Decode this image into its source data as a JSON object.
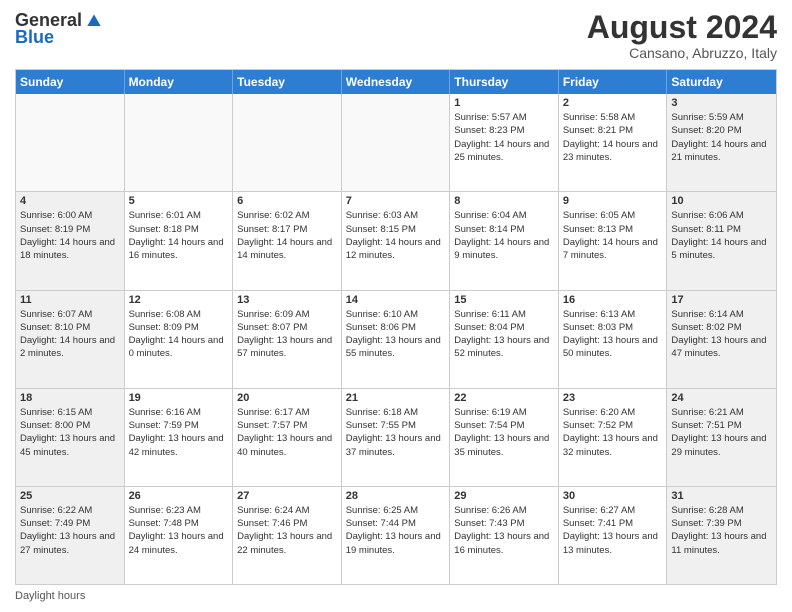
{
  "logo": {
    "general": "General",
    "blue": "Blue"
  },
  "title": "August 2024",
  "subtitle": "Cansano, Abruzzo, Italy",
  "days_of_week": [
    "Sunday",
    "Monday",
    "Tuesday",
    "Wednesday",
    "Thursday",
    "Friday",
    "Saturday"
  ],
  "footer_text": "Daylight hours",
  "weeks": [
    [
      {
        "day": "",
        "info": ""
      },
      {
        "day": "",
        "info": ""
      },
      {
        "day": "",
        "info": ""
      },
      {
        "day": "",
        "info": ""
      },
      {
        "day": "1",
        "info": "Sunrise: 5:57 AM\nSunset: 8:23 PM\nDaylight: 14 hours and 25 minutes."
      },
      {
        "day": "2",
        "info": "Sunrise: 5:58 AM\nSunset: 8:21 PM\nDaylight: 14 hours and 23 minutes."
      },
      {
        "day": "3",
        "info": "Sunrise: 5:59 AM\nSunset: 8:20 PM\nDaylight: 14 hours and 21 minutes."
      }
    ],
    [
      {
        "day": "4",
        "info": "Sunrise: 6:00 AM\nSunset: 8:19 PM\nDaylight: 14 hours and 18 minutes."
      },
      {
        "day": "5",
        "info": "Sunrise: 6:01 AM\nSunset: 8:18 PM\nDaylight: 14 hours and 16 minutes."
      },
      {
        "day": "6",
        "info": "Sunrise: 6:02 AM\nSunset: 8:17 PM\nDaylight: 14 hours and 14 minutes."
      },
      {
        "day": "7",
        "info": "Sunrise: 6:03 AM\nSunset: 8:15 PM\nDaylight: 14 hours and 12 minutes."
      },
      {
        "day": "8",
        "info": "Sunrise: 6:04 AM\nSunset: 8:14 PM\nDaylight: 14 hours and 9 minutes."
      },
      {
        "day": "9",
        "info": "Sunrise: 6:05 AM\nSunset: 8:13 PM\nDaylight: 14 hours and 7 minutes."
      },
      {
        "day": "10",
        "info": "Sunrise: 6:06 AM\nSunset: 8:11 PM\nDaylight: 14 hours and 5 minutes."
      }
    ],
    [
      {
        "day": "11",
        "info": "Sunrise: 6:07 AM\nSunset: 8:10 PM\nDaylight: 14 hours and 2 minutes."
      },
      {
        "day": "12",
        "info": "Sunrise: 6:08 AM\nSunset: 8:09 PM\nDaylight: 14 hours and 0 minutes."
      },
      {
        "day": "13",
        "info": "Sunrise: 6:09 AM\nSunset: 8:07 PM\nDaylight: 13 hours and 57 minutes."
      },
      {
        "day": "14",
        "info": "Sunrise: 6:10 AM\nSunset: 8:06 PM\nDaylight: 13 hours and 55 minutes."
      },
      {
        "day": "15",
        "info": "Sunrise: 6:11 AM\nSunset: 8:04 PM\nDaylight: 13 hours and 52 minutes."
      },
      {
        "day": "16",
        "info": "Sunrise: 6:13 AM\nSunset: 8:03 PM\nDaylight: 13 hours and 50 minutes."
      },
      {
        "day": "17",
        "info": "Sunrise: 6:14 AM\nSunset: 8:02 PM\nDaylight: 13 hours and 47 minutes."
      }
    ],
    [
      {
        "day": "18",
        "info": "Sunrise: 6:15 AM\nSunset: 8:00 PM\nDaylight: 13 hours and 45 minutes."
      },
      {
        "day": "19",
        "info": "Sunrise: 6:16 AM\nSunset: 7:59 PM\nDaylight: 13 hours and 42 minutes."
      },
      {
        "day": "20",
        "info": "Sunrise: 6:17 AM\nSunset: 7:57 PM\nDaylight: 13 hours and 40 minutes."
      },
      {
        "day": "21",
        "info": "Sunrise: 6:18 AM\nSunset: 7:55 PM\nDaylight: 13 hours and 37 minutes."
      },
      {
        "day": "22",
        "info": "Sunrise: 6:19 AM\nSunset: 7:54 PM\nDaylight: 13 hours and 35 minutes."
      },
      {
        "day": "23",
        "info": "Sunrise: 6:20 AM\nSunset: 7:52 PM\nDaylight: 13 hours and 32 minutes."
      },
      {
        "day": "24",
        "info": "Sunrise: 6:21 AM\nSunset: 7:51 PM\nDaylight: 13 hours and 29 minutes."
      }
    ],
    [
      {
        "day": "25",
        "info": "Sunrise: 6:22 AM\nSunset: 7:49 PM\nDaylight: 13 hours and 27 minutes."
      },
      {
        "day": "26",
        "info": "Sunrise: 6:23 AM\nSunset: 7:48 PM\nDaylight: 13 hours and 24 minutes."
      },
      {
        "day": "27",
        "info": "Sunrise: 6:24 AM\nSunset: 7:46 PM\nDaylight: 13 hours and 22 minutes."
      },
      {
        "day": "28",
        "info": "Sunrise: 6:25 AM\nSunset: 7:44 PM\nDaylight: 13 hours and 19 minutes."
      },
      {
        "day": "29",
        "info": "Sunrise: 6:26 AM\nSunset: 7:43 PM\nDaylight: 13 hours and 16 minutes."
      },
      {
        "day": "30",
        "info": "Sunrise: 6:27 AM\nSunset: 7:41 PM\nDaylight: 13 hours and 13 minutes."
      },
      {
        "day": "31",
        "info": "Sunrise: 6:28 AM\nSunset: 7:39 PM\nDaylight: 13 hours and 11 minutes."
      }
    ]
  ]
}
